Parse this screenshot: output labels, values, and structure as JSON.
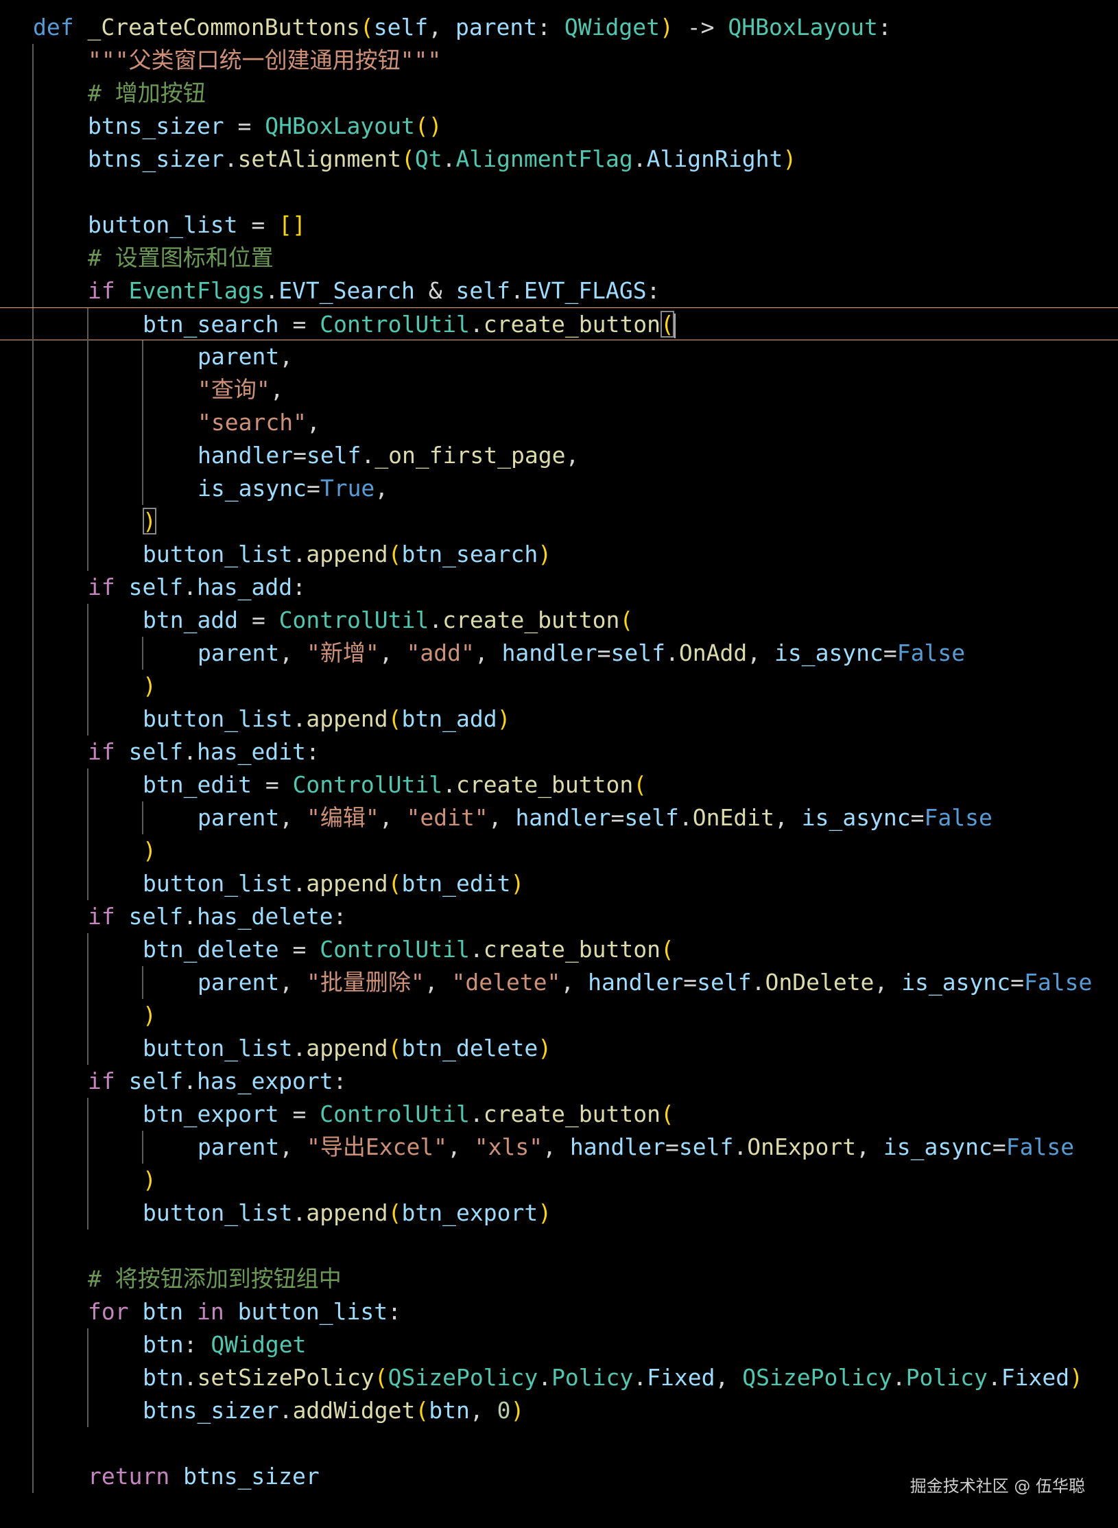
{
  "colors": {
    "background": "#000000",
    "keyword": "#c586c0",
    "def": "#569cd6",
    "function": "#dcdcaa",
    "variable": "#9cdcfe",
    "class": "#4ec9b0",
    "string": "#ce9178",
    "comment": "#6a9955",
    "bracket": "#ffd700",
    "current_line_border": "#e8a46e"
  },
  "lines": [
    {
      "tokens": [
        [
          "def",
          "def"
        ],
        [
          "punc",
          " "
        ],
        [
          "fn",
          "_CreateCommonButtons"
        ],
        [
          "br1",
          "("
        ],
        [
          "param",
          "self"
        ],
        [
          "punc",
          ", "
        ],
        [
          "param",
          "parent"
        ],
        [
          "punc",
          ": "
        ],
        [
          "cls",
          "QWidget"
        ],
        [
          "br1",
          ")"
        ],
        [
          "punc",
          " -> "
        ],
        [
          "cls",
          "QHBoxLayout"
        ],
        [
          "punc",
          ":"
        ]
      ]
    },
    {
      "tokens": [
        [
          "str",
          "\"\"\"父类窗口统一创建通用按钮\"\"\""
        ]
      ]
    },
    {
      "tokens": [
        [
          "cmt",
          "# 增加按钮"
        ]
      ]
    },
    {
      "tokens": [
        [
          "var",
          "btns_sizer"
        ],
        [
          "punc",
          " = "
        ],
        [
          "cls",
          "QHBoxLayout"
        ],
        [
          "br1",
          "()"
        ]
      ]
    },
    {
      "tokens": [
        [
          "var",
          "btns_sizer"
        ],
        [
          "punc",
          "."
        ],
        [
          "fn",
          "setAlignment"
        ],
        [
          "br1",
          "("
        ],
        [
          "cls",
          "Qt"
        ],
        [
          "punc",
          "."
        ],
        [
          "cls",
          "AlignmentFlag"
        ],
        [
          "punc",
          "."
        ],
        [
          "var",
          "AlignRight"
        ],
        [
          "br1",
          ")"
        ]
      ]
    },
    {
      "tokens": []
    },
    {
      "tokens": [
        [
          "var",
          "button_list"
        ],
        [
          "punc",
          " = "
        ],
        [
          "br1",
          "[]"
        ]
      ]
    },
    {
      "tokens": [
        [
          "cmt",
          "# 设置图标和位置"
        ]
      ]
    },
    {
      "tokens": [
        [
          "kw",
          "if"
        ],
        [
          "punc",
          " "
        ],
        [
          "cls",
          "EventFlags"
        ],
        [
          "punc",
          "."
        ],
        [
          "var",
          "EVT_Search"
        ],
        [
          "punc",
          " & "
        ],
        [
          "var",
          "self"
        ],
        [
          "punc",
          "."
        ],
        [
          "var",
          "EVT_FLAGS"
        ],
        [
          "punc",
          ":"
        ]
      ]
    },
    {
      "tokens": [
        [
          "var",
          "btn_search"
        ],
        [
          "punc",
          " = "
        ],
        [
          "cls",
          "ControlUtil"
        ],
        [
          "punc",
          "."
        ],
        [
          "fn",
          "create_button"
        ],
        [
          "br1",
          "("
        ]
      ]
    },
    {
      "tokens": [
        [
          "var",
          "parent"
        ],
        [
          "punc",
          ","
        ]
      ]
    },
    {
      "tokens": [
        [
          "str",
          "\"查询\""
        ],
        [
          "punc",
          ","
        ]
      ]
    },
    {
      "tokens": [
        [
          "str",
          "\"search\""
        ],
        [
          "punc",
          ","
        ]
      ]
    },
    {
      "tokens": [
        [
          "var",
          "handler"
        ],
        [
          "punc",
          "="
        ],
        [
          "var",
          "self"
        ],
        [
          "punc",
          "."
        ],
        [
          "fn",
          "_on_first_page"
        ],
        [
          "punc",
          ","
        ]
      ]
    },
    {
      "tokens": [
        [
          "var",
          "is_async"
        ],
        [
          "punc",
          "="
        ],
        [
          "bool",
          "True"
        ],
        [
          "punc",
          ","
        ]
      ]
    },
    {
      "tokens": [
        [
          "br1",
          ")"
        ]
      ]
    },
    {
      "tokens": [
        [
          "var",
          "button_list"
        ],
        [
          "punc",
          "."
        ],
        [
          "fn",
          "append"
        ],
        [
          "br1",
          "("
        ],
        [
          "var",
          "btn_search"
        ],
        [
          "br1",
          ")"
        ]
      ]
    },
    {
      "tokens": [
        [
          "kw",
          "if"
        ],
        [
          "punc",
          " "
        ],
        [
          "var",
          "self"
        ],
        [
          "punc",
          "."
        ],
        [
          "var",
          "has_add"
        ],
        [
          "punc",
          ":"
        ]
      ]
    },
    {
      "tokens": [
        [
          "var",
          "btn_add"
        ],
        [
          "punc",
          " = "
        ],
        [
          "cls",
          "ControlUtil"
        ],
        [
          "punc",
          "."
        ],
        [
          "fn",
          "create_button"
        ],
        [
          "br1",
          "("
        ]
      ]
    },
    {
      "tokens": [
        [
          "var",
          "parent"
        ],
        [
          "punc",
          ", "
        ],
        [
          "str",
          "\"新增\""
        ],
        [
          "punc",
          ", "
        ],
        [
          "str",
          "\"add\""
        ],
        [
          "punc",
          ", "
        ],
        [
          "var",
          "handler"
        ],
        [
          "punc",
          "="
        ],
        [
          "var",
          "self"
        ],
        [
          "punc",
          "."
        ],
        [
          "fn",
          "OnAdd"
        ],
        [
          "punc",
          ", "
        ],
        [
          "var",
          "is_async"
        ],
        [
          "punc",
          "="
        ],
        [
          "bool",
          "False"
        ]
      ]
    },
    {
      "tokens": [
        [
          "br1",
          ")"
        ]
      ]
    },
    {
      "tokens": [
        [
          "var",
          "button_list"
        ],
        [
          "punc",
          "."
        ],
        [
          "fn",
          "append"
        ],
        [
          "br1",
          "("
        ],
        [
          "var",
          "btn_add"
        ],
        [
          "br1",
          ")"
        ]
      ]
    },
    {
      "tokens": [
        [
          "kw",
          "if"
        ],
        [
          "punc",
          " "
        ],
        [
          "var",
          "self"
        ],
        [
          "punc",
          "."
        ],
        [
          "var",
          "has_edit"
        ],
        [
          "punc",
          ":"
        ]
      ]
    },
    {
      "tokens": [
        [
          "var",
          "btn_edit"
        ],
        [
          "punc",
          " = "
        ],
        [
          "cls",
          "ControlUtil"
        ],
        [
          "punc",
          "."
        ],
        [
          "fn",
          "create_button"
        ],
        [
          "br1",
          "("
        ]
      ]
    },
    {
      "tokens": [
        [
          "var",
          "parent"
        ],
        [
          "punc",
          ", "
        ],
        [
          "str",
          "\"编辑\""
        ],
        [
          "punc",
          ", "
        ],
        [
          "str",
          "\"edit\""
        ],
        [
          "punc",
          ", "
        ],
        [
          "var",
          "handler"
        ],
        [
          "punc",
          "="
        ],
        [
          "var",
          "self"
        ],
        [
          "punc",
          "."
        ],
        [
          "fn",
          "OnEdit"
        ],
        [
          "punc",
          ", "
        ],
        [
          "var",
          "is_async"
        ],
        [
          "punc",
          "="
        ],
        [
          "bool",
          "False"
        ]
      ]
    },
    {
      "tokens": [
        [
          "br1",
          ")"
        ]
      ]
    },
    {
      "tokens": [
        [
          "var",
          "button_list"
        ],
        [
          "punc",
          "."
        ],
        [
          "fn",
          "append"
        ],
        [
          "br1",
          "("
        ],
        [
          "var",
          "btn_edit"
        ],
        [
          "br1",
          ")"
        ]
      ]
    },
    {
      "tokens": [
        [
          "kw",
          "if"
        ],
        [
          "punc",
          " "
        ],
        [
          "var",
          "self"
        ],
        [
          "punc",
          "."
        ],
        [
          "var",
          "has_delete"
        ],
        [
          "punc",
          ":"
        ]
      ]
    },
    {
      "tokens": [
        [
          "var",
          "btn_delete"
        ],
        [
          "punc",
          " = "
        ],
        [
          "cls",
          "ControlUtil"
        ],
        [
          "punc",
          "."
        ],
        [
          "fn",
          "create_button"
        ],
        [
          "br1",
          "("
        ]
      ]
    },
    {
      "tokens": [
        [
          "var",
          "parent"
        ],
        [
          "punc",
          ", "
        ],
        [
          "str",
          "\"批量删除\""
        ],
        [
          "punc",
          ", "
        ],
        [
          "str",
          "\"delete\""
        ],
        [
          "punc",
          ", "
        ],
        [
          "var",
          "handler"
        ],
        [
          "punc",
          "="
        ],
        [
          "var",
          "self"
        ],
        [
          "punc",
          "."
        ],
        [
          "fn",
          "OnDelete"
        ],
        [
          "punc",
          ", "
        ],
        [
          "var",
          "is_async"
        ],
        [
          "punc",
          "="
        ],
        [
          "bool",
          "False"
        ]
      ]
    },
    {
      "tokens": [
        [
          "br1",
          ")"
        ]
      ]
    },
    {
      "tokens": [
        [
          "var",
          "button_list"
        ],
        [
          "punc",
          "."
        ],
        [
          "fn",
          "append"
        ],
        [
          "br1",
          "("
        ],
        [
          "var",
          "btn_delete"
        ],
        [
          "br1",
          ")"
        ]
      ]
    },
    {
      "tokens": [
        [
          "kw",
          "if"
        ],
        [
          "punc",
          " "
        ],
        [
          "var",
          "self"
        ],
        [
          "punc",
          "."
        ],
        [
          "var",
          "has_export"
        ],
        [
          "punc",
          ":"
        ]
      ]
    },
    {
      "tokens": [
        [
          "var",
          "btn_export"
        ],
        [
          "punc",
          " = "
        ],
        [
          "cls",
          "ControlUtil"
        ],
        [
          "punc",
          "."
        ],
        [
          "fn",
          "create_button"
        ],
        [
          "br1",
          "("
        ]
      ]
    },
    {
      "tokens": [
        [
          "var",
          "parent"
        ],
        [
          "punc",
          ", "
        ],
        [
          "str",
          "\"导出Excel\""
        ],
        [
          "punc",
          ", "
        ],
        [
          "str",
          "\"xls\""
        ],
        [
          "punc",
          ", "
        ],
        [
          "var",
          "handler"
        ],
        [
          "punc",
          "="
        ],
        [
          "var",
          "self"
        ],
        [
          "punc",
          "."
        ],
        [
          "fn",
          "OnExport"
        ],
        [
          "punc",
          ", "
        ],
        [
          "var",
          "is_async"
        ],
        [
          "punc",
          "="
        ],
        [
          "bool",
          "False"
        ]
      ]
    },
    {
      "tokens": [
        [
          "br1",
          ")"
        ]
      ]
    },
    {
      "tokens": [
        [
          "var",
          "button_list"
        ],
        [
          "punc",
          "."
        ],
        [
          "fn",
          "append"
        ],
        [
          "br1",
          "("
        ],
        [
          "var",
          "btn_export"
        ],
        [
          "br1",
          ")"
        ]
      ]
    },
    {
      "tokens": []
    },
    {
      "tokens": [
        [
          "cmt",
          "# 将按钮添加到按钮组中"
        ]
      ]
    },
    {
      "tokens": [
        [
          "kw",
          "for"
        ],
        [
          "punc",
          " "
        ],
        [
          "var",
          "btn"
        ],
        [
          "punc",
          " "
        ],
        [
          "kw",
          "in"
        ],
        [
          "punc",
          " "
        ],
        [
          "var",
          "button_list"
        ],
        [
          "punc",
          ":"
        ]
      ]
    },
    {
      "tokens": [
        [
          "var",
          "btn"
        ],
        [
          "punc",
          ": "
        ],
        [
          "cls",
          "QWidget"
        ]
      ]
    },
    {
      "tokens": [
        [
          "var",
          "btn"
        ],
        [
          "punc",
          "."
        ],
        [
          "fn",
          "setSizePolicy"
        ],
        [
          "br1",
          "("
        ],
        [
          "cls",
          "QSizePolicy"
        ],
        [
          "punc",
          "."
        ],
        [
          "cls",
          "Policy"
        ],
        [
          "punc",
          "."
        ],
        [
          "var",
          "Fixed"
        ],
        [
          "punc",
          ", "
        ],
        [
          "cls",
          "QSizePolicy"
        ],
        [
          "punc",
          "."
        ],
        [
          "cls",
          "Policy"
        ],
        [
          "punc",
          "."
        ],
        [
          "var",
          "Fixed"
        ],
        [
          "br1",
          ")"
        ]
      ]
    },
    {
      "tokens": [
        [
          "var",
          "btns_sizer"
        ],
        [
          "punc",
          "."
        ],
        [
          "fn",
          "addWidget"
        ],
        [
          "br1",
          "("
        ],
        [
          "var",
          "btn"
        ],
        [
          "punc",
          ", "
        ],
        [
          "num",
          "0"
        ],
        [
          "br1",
          ")"
        ]
      ]
    },
    {
      "tokens": []
    },
    {
      "tokens": [
        [
          "kw",
          "return"
        ],
        [
          "punc",
          " "
        ],
        [
          "var",
          "btns_sizer"
        ]
      ]
    }
  ],
  "watermark": "掘金技术社区 @ 伍华聪"
}
